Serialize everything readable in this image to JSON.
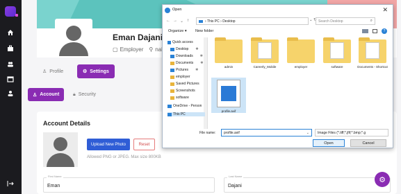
{
  "sidebar": {
    "icons": [
      "app-logo",
      "home-icon",
      "briefcase-icon",
      "users-icon",
      "calendar-icon",
      "user-icon",
      "logout-icon"
    ]
  },
  "profile": {
    "name": "Eman Dajani",
    "role": "Employer",
    "location": "nablus"
  },
  "tabs": {
    "profile": "Profile",
    "settings": "Settings",
    "account": "Account",
    "security": "Security"
  },
  "account": {
    "title": "Account Details",
    "upload_label": "Upload New Photo",
    "reset_label": "Reset",
    "hint": "Allowed PNG or JPEG. Max size 800KB",
    "first_name_label": "First Name",
    "first_name": "Eman",
    "last_name_label": "Last Name",
    "last_name": "Dajani"
  },
  "dialog": {
    "title": "Open",
    "breadcrumb": "› This PC › Desktop",
    "search_placeholder": "Search Desktop",
    "organize": "Organize ▾",
    "new_folder": "New folder",
    "nav_items": [
      {
        "label": "Quick access",
        "icon": "star"
      },
      {
        "label": "Desktop",
        "icon": "blue",
        "pin": "✱"
      },
      {
        "label": "Downloads",
        "icon": "blue",
        "pin": "✱"
      },
      {
        "label": "Documents",
        "icon": "doc",
        "pin": "✱"
      },
      {
        "label": "Pictures",
        "icon": "blue",
        "pin": "✱"
      },
      {
        "label": "employer",
        "icon": "folder"
      },
      {
        "label": "Saved Pictures",
        "icon": "folder"
      },
      {
        "label": "Screenshots",
        "icon": "folder"
      },
      {
        "label": "software",
        "icon": "folder"
      },
      {
        "label": "OneDrive - Person",
        "icon": "blue"
      },
      {
        "label": "This PC",
        "icon": "blue"
      }
    ],
    "files": [
      "admin",
      "Careerly_Mobile",
      "employer",
      "software",
      "Documents - Shortcut",
      "profile.avif"
    ],
    "file_name_label": "File name:",
    "file_name": "profile.avif",
    "file_filter": "Image Files (*.tiff;*.jfif;*.bmp;*.g",
    "open_label": "Open",
    "cancel_label": "Cancel"
  },
  "colors": {
    "accent": "#8a2cb3",
    "primary_button": "#2f5dd6",
    "sidebar": "#1b1b1f"
  }
}
